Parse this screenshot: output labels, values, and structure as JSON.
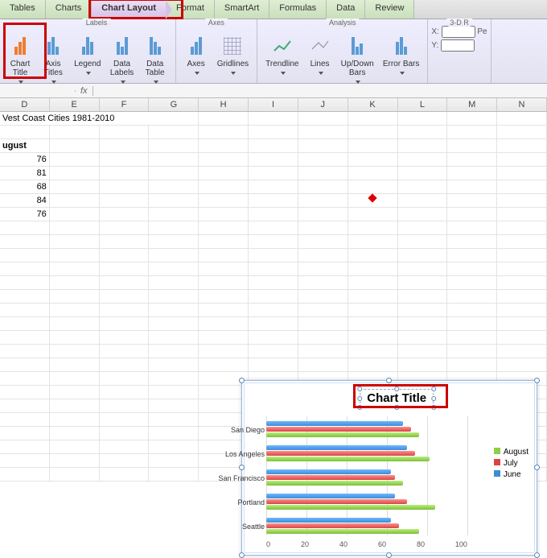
{
  "tabs": [
    "Tables",
    "Charts",
    "Chart Layout",
    "Format",
    "SmartArt",
    "Formulas",
    "Data",
    "Review"
  ],
  "active_tab_index": 2,
  "ribbon": {
    "groups": {
      "labels_group": "Labels",
      "axes_group": "Axes",
      "analysis_group": "Analysis",
      "rotation_group": "3-D R"
    },
    "buttons": {
      "chart_title": "Chart\nTitle",
      "axis_titles": "Axis\nTitles",
      "legend": "Legend",
      "data_labels": "Data\nLabels",
      "data_table": "Data\nTable",
      "axes": "Axes",
      "gridlines": "Gridlines",
      "trendline": "Trendline",
      "lines": "Lines",
      "updown": "Up/Down\nBars",
      "error_bars": "Error Bars"
    },
    "rotation": {
      "x_label": "X:",
      "y_label": "Y:",
      "pe_label": "Pe"
    }
  },
  "namebox": "",
  "columns": [
    "D",
    "E",
    "F",
    "G",
    "H",
    "I",
    "J",
    "K",
    "L",
    "M",
    "N"
  ],
  "sheet": {
    "title_text": "Vest Coast Cities 1981-2010",
    "col_label": "ugust",
    "values": [
      76,
      81,
      68,
      84,
      76
    ]
  },
  "chart_object": {
    "title": "Chart Title",
    "legend": [
      "August",
      "July",
      "June"
    ]
  },
  "chart_data": {
    "type": "bar",
    "orientation": "horizontal",
    "title": "Chart Title",
    "categories": [
      "San Diego",
      "Los Angeles",
      "San Francisco",
      "Portland",
      "Seattle"
    ],
    "series": [
      {
        "name": "June",
        "values": [
          68,
          70,
          62,
          64,
          62
        ]
      },
      {
        "name": "July",
        "values": [
          72,
          74,
          64,
          70,
          66
        ]
      },
      {
        "name": "August",
        "values": [
          76,
          81,
          68,
          84,
          76
        ]
      }
    ],
    "xlabel": "",
    "ylabel": "",
    "xlim": [
      0,
      100
    ],
    "xticks": [
      0,
      20,
      40,
      60,
      80,
      100
    ],
    "legend_position": "right"
  }
}
